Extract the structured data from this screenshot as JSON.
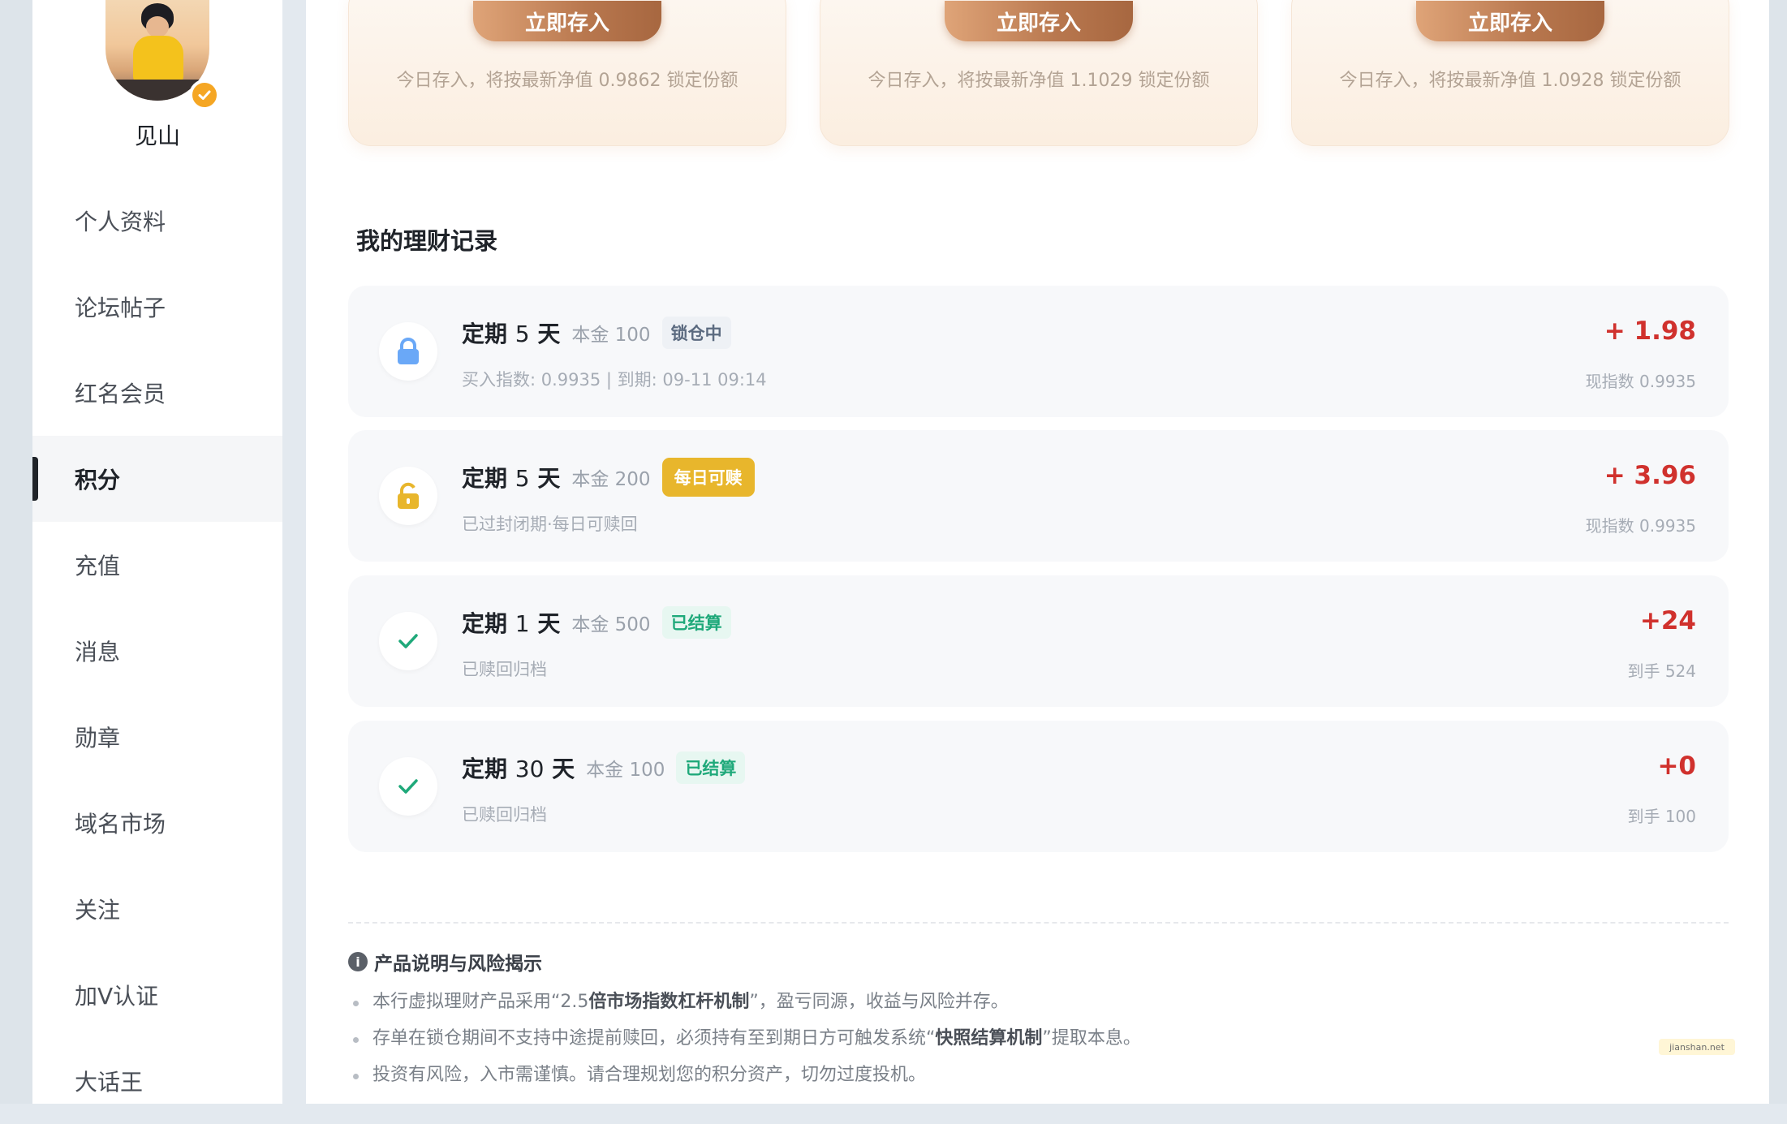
{
  "user": {
    "name": "见山"
  },
  "sidebar": {
    "items": [
      {
        "label": "个人资料",
        "active": false
      },
      {
        "label": "论坛帖子",
        "active": false
      },
      {
        "label": "红名会员",
        "active": false
      },
      {
        "label": "积分",
        "active": true
      },
      {
        "label": "充值",
        "active": false
      },
      {
        "label": "消息",
        "active": false
      },
      {
        "label": "勋章",
        "active": false
      },
      {
        "label": "域名市场",
        "active": false
      },
      {
        "label": "关注",
        "active": false
      },
      {
        "label": "加V认证",
        "active": false
      },
      {
        "label": "大话王",
        "active": false
      }
    ]
  },
  "deposit_cards": [
    {
      "button": "立即存入",
      "note": "今日存入，将按最新净值 0.9862 锁定份额"
    },
    {
      "button": "立即存入",
      "note": "今日存入，将按最新净值 1.1029 锁定份额"
    },
    {
      "button": "立即存入",
      "note": "今日存入，将按最新净值 1.0928 锁定份额"
    }
  ],
  "records_title": "我的理财记录",
  "records": [
    {
      "prefix": "定期",
      "days": "5",
      "unit": "天",
      "principal": "本金 100",
      "badge": "锁仓中",
      "sub": "买入指数: 0.9935 | 到期: 09-11 09:14",
      "amount": "+ 1.98",
      "meta": "现指数 0.9935",
      "icon": "lock-icon"
    },
    {
      "prefix": "定期",
      "days": "5",
      "unit": "天",
      "principal": "本金 200",
      "badge": "每日可赎",
      "sub": "已过封闭期·每日可赎回",
      "amount": "+ 3.96",
      "meta": "现指数 0.9935",
      "icon": "unlock-icon"
    },
    {
      "prefix": "定期",
      "days": "1",
      "unit": "天",
      "principal": "本金 500",
      "badge": "已结算",
      "sub": "已赎回归档",
      "amount": "+24",
      "meta": "到手 524",
      "icon": "check-icon"
    },
    {
      "prefix": "定期",
      "days": "30",
      "unit": "天",
      "principal": "本金 100",
      "badge": "已结算",
      "sub": "已赎回归档",
      "amount": "+0",
      "meta": "到手 100",
      "icon": "check-icon"
    }
  ],
  "notice": {
    "icon": "info-icon",
    "title": "产品说明与风险揭示",
    "items": [
      {
        "pre": "本行虚拟理财产品采用“2.5",
        "bold": "倍市场指数杠杆机制",
        "post": "”，盈亏同源，收益与风险并存。"
      },
      {
        "pre": "存单在锁仓期间不支持中途提前赎回，必须持有至到期日方可触发系统“",
        "bold": "快照结算机制",
        "post": "”提取本息。"
      },
      {
        "pre": "投资有风险，入市需谨慎。请合理规划您的积分资产，切勿过度投机。",
        "bold": "",
        "post": ""
      }
    ]
  },
  "watermark": "jianshan.net",
  "colors": {
    "accent": "#b8774e",
    "positive": "#d0312d",
    "lock": "#6aa8f7",
    "daily": "#e8b62c",
    "settled": "#1fa97a"
  }
}
